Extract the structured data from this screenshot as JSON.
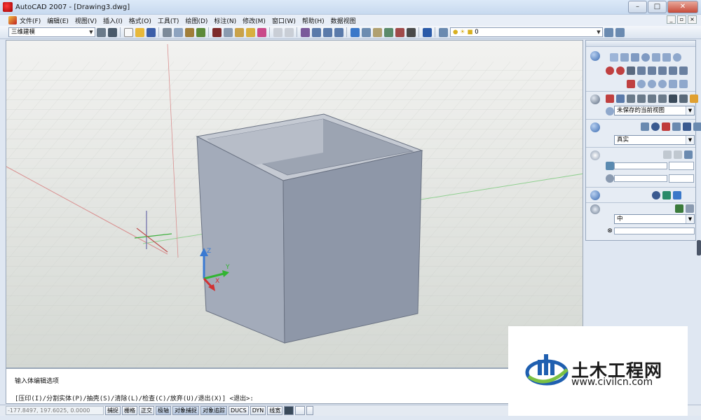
{
  "window": {
    "title": "AutoCAD 2007 - [Drawing3.dwg]",
    "buttons": [
      "–",
      "□",
      "✕"
    ]
  },
  "menubar": {
    "items": [
      "文件(F)",
      "编辑(E)",
      "视图(V)",
      "插入(I)",
      "格式(O)",
      "工具(T)",
      "绘图(D)",
      "标注(N)",
      "修改(M)",
      "窗口(W)",
      "帮助(H)",
      "数据视图"
    ],
    "mdi_buttons": [
      "_",
      "▫",
      "×"
    ]
  },
  "toolbar": {
    "workspace": "三维建模",
    "layer_value": "0"
  },
  "canvas": {
    "ucs_labels": {
      "z": "Z",
      "y": "Y",
      "x": "X"
    },
    "colors": {
      "cube_front": "#8c96a8",
      "cube_side": "#a7b0bf",
      "cube_top": "#c0c6d0",
      "axis_red": "#d23232",
      "axis_green": "#32b432",
      "axis_blue": "#3a7ad2"
    }
  },
  "palette": {
    "view_select": "未保存的当前视图",
    "visual_style_select": "真实",
    "material_select": "中"
  },
  "command": {
    "line1": "输入体编辑选项",
    "line2": "[压印(I)/分割实体(P)/抽壳(S)/清除(L)/检查(C)/放弃(U)/退出(X)] <退出>:"
  },
  "statusbar": {
    "coords": "-177.8497, 197.6025, 0.0000",
    "buttons": [
      "捕捉",
      "栅格",
      "正交",
      "极轴",
      "对象捕捉",
      "对象追踪",
      "DUCS",
      "DYN",
      "线宽"
    ]
  },
  "watermark": {
    "title": "土木工程网",
    "url": "www.civilcn.com"
  }
}
